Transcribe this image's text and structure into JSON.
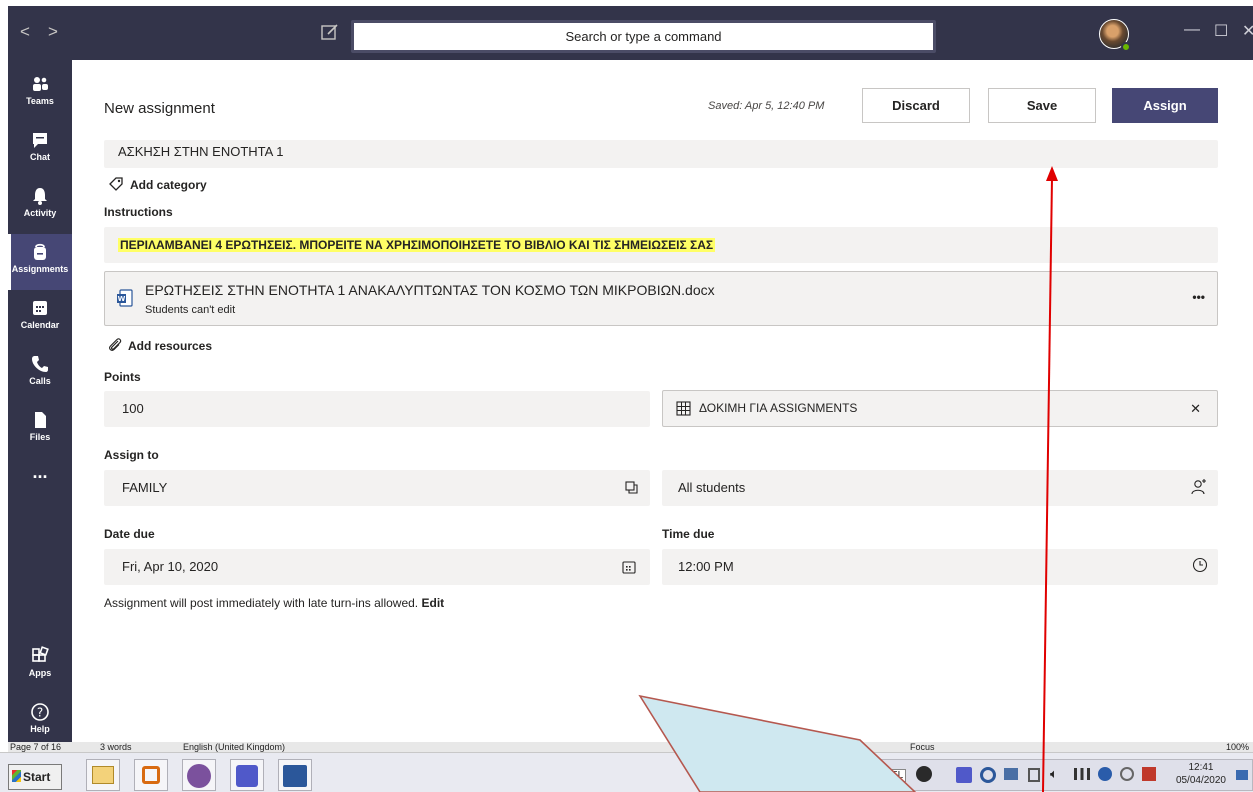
{
  "titlebar": {
    "nav_back": "<",
    "nav_forward": ">",
    "search_placeholder": "Search or type a command"
  },
  "rail": [
    {
      "label": "Teams"
    },
    {
      "label": "Chat"
    },
    {
      "label": "Activity"
    },
    {
      "label": "Assignments"
    },
    {
      "label": "Calendar"
    },
    {
      "label": "Calls"
    },
    {
      "label": "Files"
    },
    {
      "label": "..."
    },
    {
      "label": "Apps"
    },
    {
      "label": "Help"
    }
  ],
  "header": {
    "title": "New assignment",
    "saved": "Saved: Apr 5, 12:40 PM",
    "discard": "Discard",
    "save": "Save",
    "assign": "Assign"
  },
  "form": {
    "assignment_title": "ΑΣΚΗΣΗ ΣΤΗΝ ΕΝΟΤΗΤΑ 1",
    "add_category": "Add category",
    "instructions_label": "Instructions",
    "instructions": "ΠΕΡΙΛΑΜΒΑΝΕΙ 4 ΕΡΩΤΗΣΕΙΣ. ΜΠΟΡΕΙΤΕ ΝΑ ΧΡΗΣΙΜΟΠΟΙΗΣΕΤΕ ΤΟ ΒΙΒΛΙΟ ΚΑΙ ΤΙΣ ΣΗΜΕΙΩΣΕΙΣ ΣΑΣ",
    "resource_name": "ΕΡΩΤΗΣΕΙΣ ΣΤΗΝ ΕΝΟΤΗΤΑ 1 ΑΝΑΚΑΛΥΠΤΩΝΤΑΣ ΤΟΝ ΚΟΣΜΟ ΤΩΝ ΜΙΚΡΟΒΙΩΝ.docx",
    "resource_perm": "Students can't edit",
    "resource_more": "•••",
    "add_resources": "Add resources",
    "points_label": "Points",
    "points": "100",
    "rubric": "ΔΟΚΙΜΗ ΓΙΑ ASSIGNMENTS",
    "rubric_close": "✕",
    "assign_to_label": "Assign to",
    "class": "FAMILY",
    "students": "All students",
    "date_due_label": "Date due",
    "date_due": "Fri, Apr 10, 2020",
    "time_due_label": "Time due",
    "time_due": "12:00 PM",
    "post_note": "Assignment will post immediately with late turn-ins allowed.",
    "edit_link": "Edit"
  },
  "word_status": {
    "page": "Page 7 of 16",
    "words": "3 words",
    "language": "English (United Kingdom)",
    "focus": "Focus",
    "zoom": "100%"
  },
  "taskbar": {
    "start": "Start",
    "lang": "EL",
    "time": "12:41",
    "date": "05/04/2020"
  },
  "colors": {
    "teams_dark": "#33344a",
    "brand": "#464775",
    "highlight": "#ffff66",
    "arrow": "#e00000",
    "callout": "#cfe8f0"
  }
}
